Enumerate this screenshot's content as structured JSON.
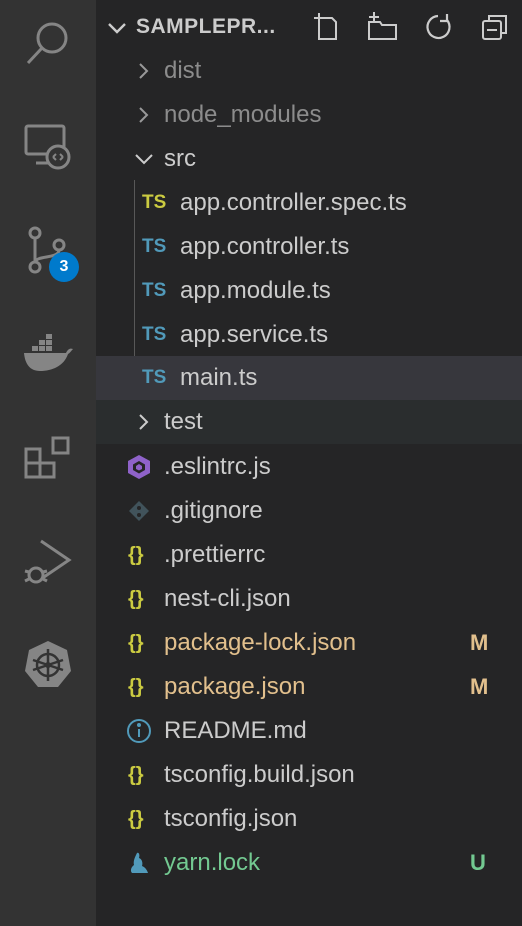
{
  "activity_bar": {
    "items": [
      {
        "name": "search-icon"
      },
      {
        "name": "remote-explorer-icon"
      },
      {
        "name": "source-control-icon",
        "badge": "3"
      },
      {
        "name": "docker-icon"
      },
      {
        "name": "extensions-icon"
      },
      {
        "name": "run-debug-icon"
      },
      {
        "name": "kubernetes-icon"
      }
    ],
    "badge_color": "#007acc"
  },
  "explorer": {
    "title": "SAMPLEPR...",
    "toolbar": [
      "new-file-icon",
      "new-folder-icon",
      "refresh-icon",
      "collapse-all-icon"
    ],
    "tree": [
      {
        "label": "dist",
        "type": "folder",
        "expanded": false,
        "dimmed": true
      },
      {
        "label": "node_modules",
        "type": "folder",
        "expanded": false,
        "dimmed": true
      },
      {
        "label": "src",
        "type": "folder",
        "expanded": true
      },
      {
        "label": "app.controller.spec.ts",
        "type": "file",
        "icon_text": "TS",
        "icon_color": "#cbcb41"
      },
      {
        "label": "app.controller.ts",
        "type": "file",
        "icon_text": "TS",
        "icon_color": "#519aba"
      },
      {
        "label": "app.module.ts",
        "type": "file",
        "icon_text": "TS",
        "icon_color": "#519aba"
      },
      {
        "label": "app.service.ts",
        "type": "file",
        "icon_text": "TS",
        "icon_color": "#519aba"
      },
      {
        "label": "main.ts",
        "type": "file",
        "icon_text": "TS",
        "icon_color": "#519aba",
        "selected": true
      },
      {
        "label": "test",
        "type": "folder",
        "expanded": false
      },
      {
        "label": ".eslintrc.js",
        "type": "file",
        "icon": "eslint-icon"
      },
      {
        "label": ".gitignore",
        "type": "file",
        "icon": "git-icon"
      },
      {
        "label": ".prettierrc",
        "type": "file",
        "icon_text": "{}",
        "icon_color": "#cbcb41"
      },
      {
        "label": "nest-cli.json",
        "type": "file",
        "icon_text": "{}",
        "icon_color": "#cbcb41"
      },
      {
        "label": "package-lock.json",
        "type": "file",
        "icon_text": "{}",
        "icon_color": "#cbcb41",
        "status": "M",
        "status_color": "#e2c08d"
      },
      {
        "label": "package.json",
        "type": "file",
        "icon_text": "{}",
        "icon_color": "#cbcb41",
        "status": "M",
        "status_color": "#e2c08d"
      },
      {
        "label": "README.md",
        "type": "file",
        "icon": "info-icon"
      },
      {
        "label": "tsconfig.build.json",
        "type": "file",
        "icon_text": "{}",
        "icon_color": "#cbcb41"
      },
      {
        "label": "tsconfig.json",
        "type": "file",
        "icon_text": "{}",
        "icon_color": "#cbcb41"
      },
      {
        "label": "yarn.lock",
        "type": "file",
        "icon": "yarn-icon",
        "status": "U",
        "status_color": "#73c991"
      }
    ]
  }
}
